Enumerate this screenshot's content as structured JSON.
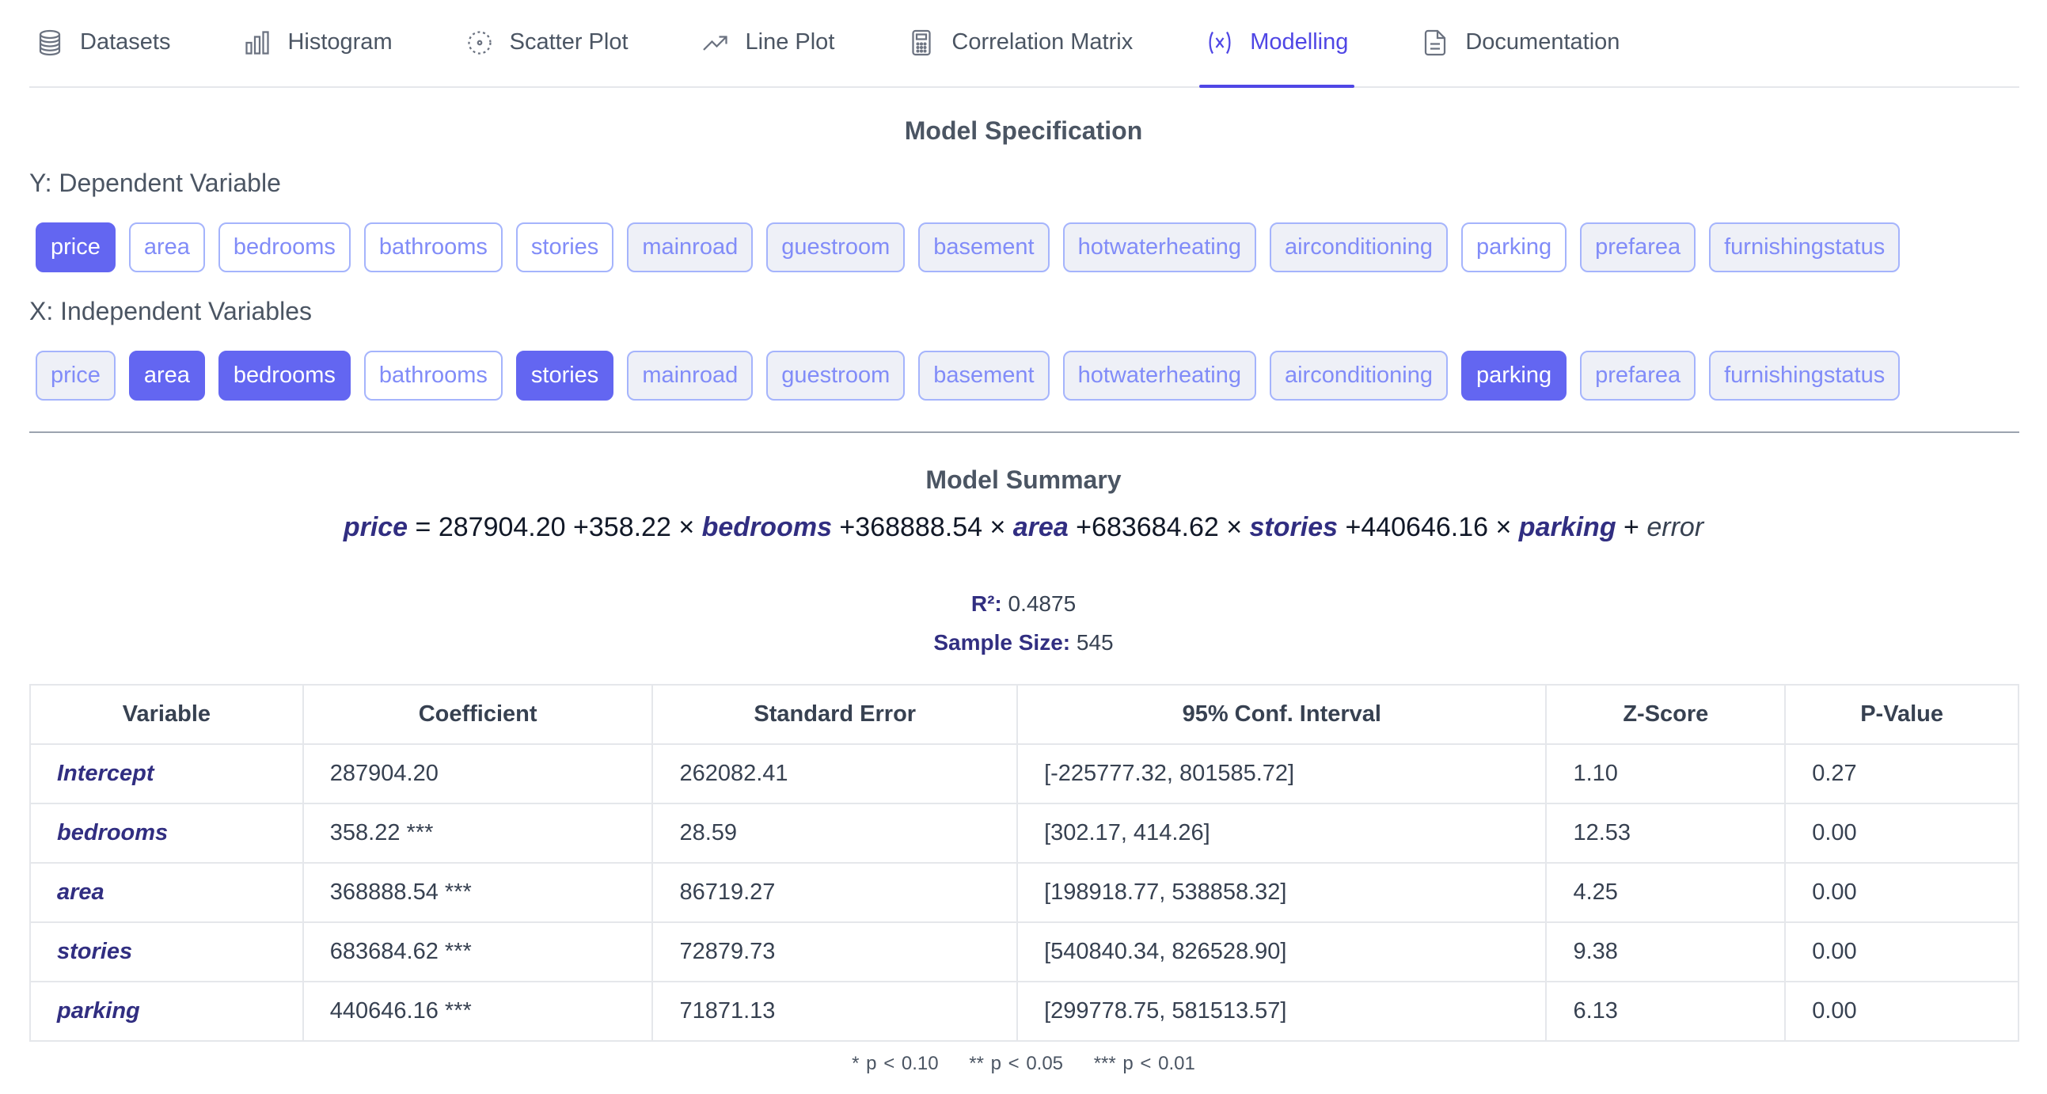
{
  "tabs": [
    {
      "label": "Datasets",
      "icon": "database-icon",
      "active": false
    },
    {
      "label": "Histogram",
      "icon": "histogram-icon",
      "active": false
    },
    {
      "label": "Scatter Plot",
      "icon": "scatter-icon",
      "active": false
    },
    {
      "label": "Line Plot",
      "icon": "trend-line-icon",
      "active": false
    },
    {
      "label": "Correlation Matrix",
      "icon": "calculator-icon",
      "active": false
    },
    {
      "label": "Modelling",
      "icon": "variable-icon",
      "active": true
    },
    {
      "label": "Documentation",
      "icon": "document-icon",
      "active": false
    }
  ],
  "spec": {
    "title": "Model Specification",
    "y_label": "Y: Dependent Variable",
    "x_label": "X: Independent Variables",
    "variables": [
      "price",
      "area",
      "bedrooms",
      "bathrooms",
      "stories",
      "mainroad",
      "guestroom",
      "basement",
      "hotwaterheating",
      "airconditioning",
      "parking",
      "prefarea",
      "furnishingstatus"
    ],
    "categorical": [
      "mainroad",
      "guestroom",
      "basement",
      "hotwaterheating",
      "airconditioning",
      "prefarea",
      "furnishingstatus"
    ],
    "y_selected": [
      "price"
    ],
    "x_selected": [
      "area",
      "bedrooms",
      "stories",
      "parking"
    ],
    "x_disabled": [
      "price"
    ]
  },
  "summary": {
    "title": "Model Summary",
    "equation": {
      "lhs": "price",
      "equals": " = ",
      "intercept": "287904.20",
      "terms": [
        {
          "coef": " +358.22 × ",
          "var": "bedrooms"
        },
        {
          "coef": " +368888.54 × ",
          "var": "area"
        },
        {
          "coef": " +683684.62 × ",
          "var": "stories"
        },
        {
          "coef": " +440646.16 × ",
          "var": "parking"
        }
      ],
      "plus": " + ",
      "error": "error"
    },
    "r2_label": "R²:",
    "r2_value": " 0.4875",
    "n_label": "Sample Size:",
    "n_value": " 545"
  },
  "table": {
    "headers": [
      "Variable",
      "Coefficient",
      "Standard Error",
      "95% Conf. Interval",
      "Z-Score",
      "P-Value"
    ],
    "rows": [
      [
        "Intercept",
        "287904.20",
        "262082.41",
        "[-225777.32, 801585.72]",
        "1.10",
        "0.27"
      ],
      [
        "bedrooms",
        "358.22 ***",
        "28.59",
        "[302.17, 414.26]",
        "12.53",
        "0.00"
      ],
      [
        "area",
        "368888.54 ***",
        "86719.27",
        "[198918.77, 538858.32]",
        "4.25",
        "0.00"
      ],
      [
        "stories",
        "683684.62 ***",
        "72879.73",
        "[540840.34, 826528.90]",
        "9.38",
        "0.00"
      ],
      [
        "parking",
        "440646.16 ***",
        "71871.13",
        "[299778.75, 581513.57]",
        "6.13",
        "0.00"
      ]
    ]
  },
  "footnote": [
    "* p < 0.10",
    "** p < 0.05",
    "*** p < 0.01"
  ],
  "colors": {
    "accent": "#6366f1",
    "accent_dark": "#4f46e5",
    "var_text": "#312e81"
  }
}
